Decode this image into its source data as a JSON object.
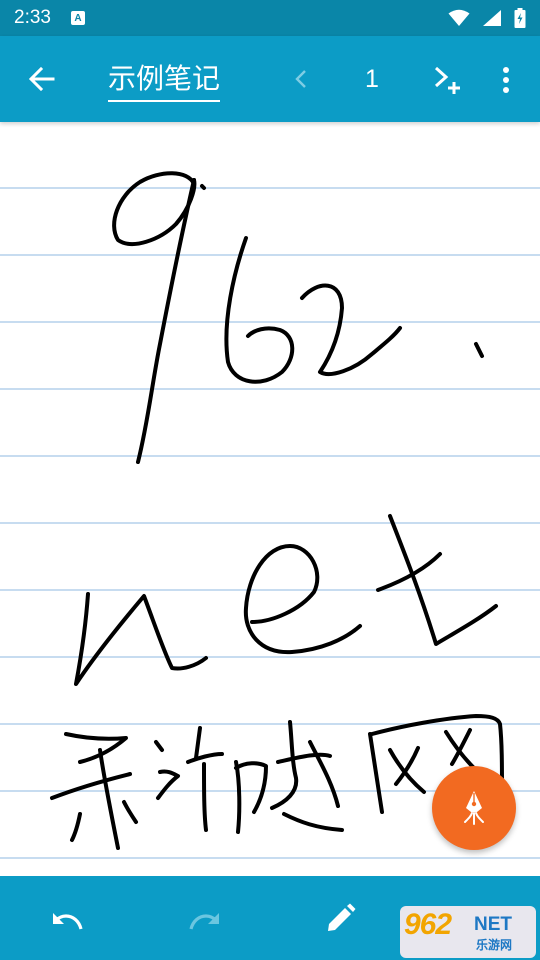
{
  "status_bar": {
    "time": "2:33",
    "notification_icon": "A"
  },
  "app_bar": {
    "title": "示例笔记",
    "page_number": "1"
  },
  "watermark": {
    "logo": "962",
    "suffix": "NET",
    "subtitle": "乐游网"
  },
  "colors": {
    "status_bar": "#0a86a8",
    "app_bar": "#0c9cc6",
    "fab": "#f26a21",
    "ruled_line": "#c7dcf0",
    "ink": "#000000"
  },
  "icons": {
    "back": "arrow-left-icon",
    "prev": "chevron-left-icon",
    "next_add": "chevron-right-plus-icon",
    "menu": "more-vert-icon",
    "undo": "undo-icon",
    "redo": "redo-icon",
    "pen": "pencil-icon",
    "fab": "fountain-pen-icon"
  }
}
